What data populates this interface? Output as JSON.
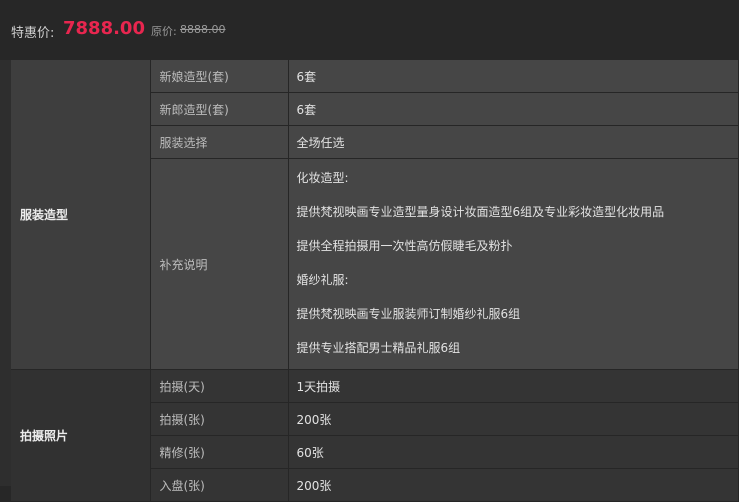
{
  "price": {
    "label": "特惠价:",
    "value": "7888.00",
    "original_label": "原价:",
    "original_value": "8888.00"
  },
  "groups": [
    {
      "name": "服装造型",
      "rows": [
        {
          "label": "新娘造型(套)",
          "value": "6套"
        },
        {
          "label": "新郎造型(套)",
          "value": "6套"
        },
        {
          "label": "服装选择",
          "value": "全场任选"
        },
        {
          "label": "补充说明",
          "lines": [
            "化妆造型:",
            "提供梵视映画专业造型量身设计妆面造型6组及专业彩妆造型化妆用品",
            "提供全程拍摄用一次性高仿假睫毛及粉扑",
            "婚纱礼服:",
            "提供梵视映画专业服装师订制婚纱礼服6组",
            "提供专业搭配男士精品礼服6组"
          ]
        }
      ]
    },
    {
      "name": "拍摄照片",
      "rows": [
        {
          "label": "拍摄(天)",
          "value": "1天拍摄"
        },
        {
          "label": "拍摄(张)",
          "value": "200张"
        },
        {
          "label": "精修(张)",
          "value": "60张"
        },
        {
          "label": "入盘(张)",
          "value": "200张"
        }
      ]
    }
  ],
  "colors": {
    "accent_price": "#e8264f",
    "background": "#272727"
  }
}
